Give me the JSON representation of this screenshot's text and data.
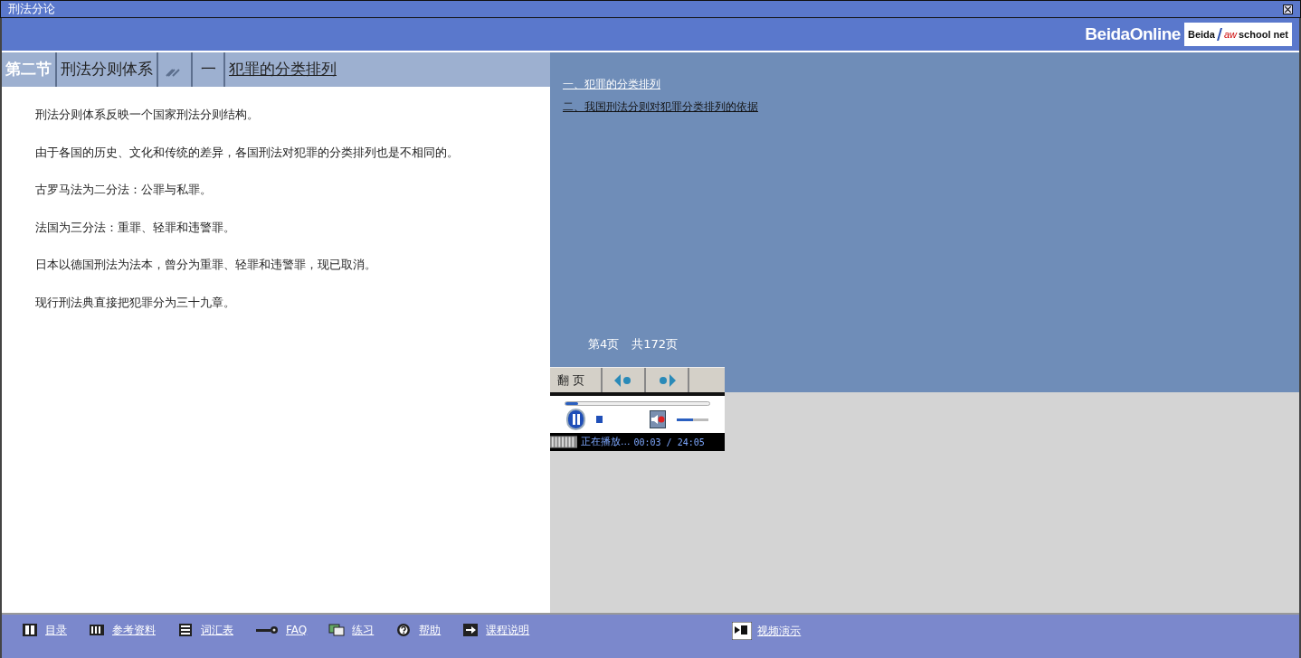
{
  "window": {
    "title": "刑法分论"
  },
  "header": {
    "brand": "BeidaOnline",
    "badge": [
      "Beida",
      "aw",
      "school net"
    ]
  },
  "breadcrumb": [
    {
      "kind": "section",
      "label": "第二节"
    },
    {
      "kind": "text",
      "label": "刑法分则体系"
    },
    {
      "kind": "arrows"
    },
    {
      "kind": "text",
      "label": "一"
    },
    {
      "kind": "link",
      "label": "犯罪的分类排列"
    }
  ],
  "paragraphs": [
    "刑法分则体系反映一个国家刑法分则结构。",
    "由于各国的历史、文化和传统的差异，各国刑法对犯罪的分类排列也是不相同的。",
    "古罗马法为二分法：公罪与私罪。",
    "法国为三分法：重罪、轻罪和违警罪。",
    "日本以德国刑法为法本，曾分为重罪、轻罪和违警罪，现已取消。",
    "现行刑法典直接把犯罪分为三十九章。"
  ],
  "outline": [
    {
      "label": "一、犯罪的分类排列",
      "selected": true
    },
    {
      "label": "二、我国刑法分则对犯罪分类排列的依据",
      "selected": false
    }
  ],
  "page_indicator": {
    "current": "第4页",
    "total": "共172页"
  },
  "pager": {
    "label": "翻 页"
  },
  "player": {
    "playing": true,
    "progress": {
      "level": 0.05
    },
    "muted": true,
    "volume": {
      "level": 0.5
    },
    "status": "正在播放...",
    "time": "00:03 / 24:05"
  },
  "toolbar": [
    {
      "kind": "book",
      "label": "目录"
    },
    {
      "kind": "piano",
      "label": "参考资料"
    },
    {
      "kind": "list",
      "label": "词汇表"
    },
    {
      "kind": "key",
      "label": "FAQ"
    },
    {
      "kind": "cards",
      "label": "练习"
    },
    {
      "kind": "help",
      "label": "帮助"
    },
    {
      "kind": "arrow",
      "label": "课程说明"
    }
  ],
  "video_link": {
    "label": "视频演示"
  }
}
